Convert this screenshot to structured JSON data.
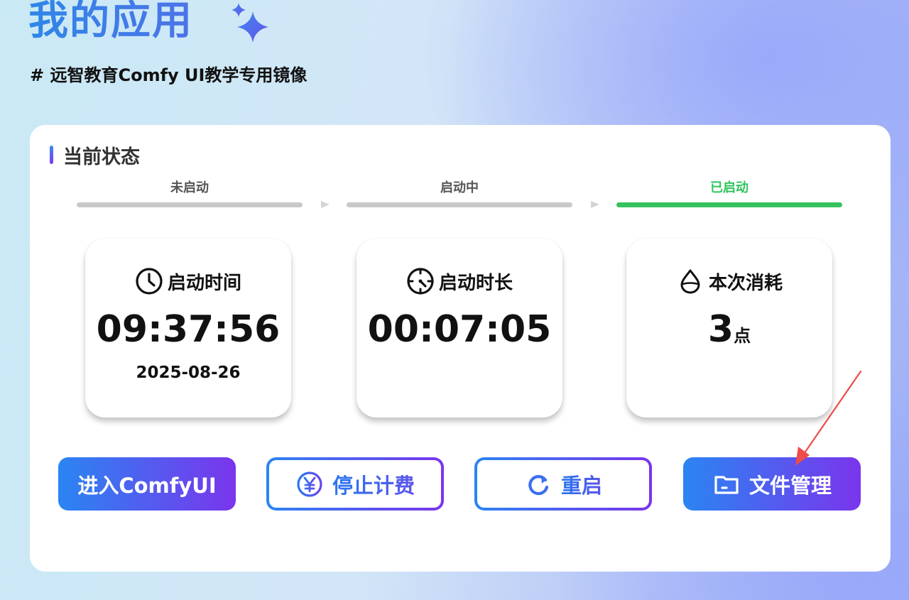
{
  "header": {
    "title": "我的应用",
    "subtitle": "# 远智教育Comfy UI教学专用镜像"
  },
  "status": {
    "section_title": "当前状态",
    "steps": [
      {
        "label": "未启动",
        "active": false
      },
      {
        "label": "启动中",
        "active": false
      },
      {
        "label": "已启动",
        "active": true
      }
    ]
  },
  "stats": {
    "start_time": {
      "label": "启动时间",
      "value": "09:37:56",
      "date": "2025-08-26",
      "icon": "clock-icon"
    },
    "duration": {
      "label": "启动时长",
      "value": "00:07:05",
      "icon": "timer-icon"
    },
    "consumption": {
      "label": "本次消耗",
      "value": "3",
      "unit": "点",
      "icon": "drop-icon"
    }
  },
  "actions": {
    "enter": "进入ComfyUI",
    "stop_billing": "停止计费",
    "restart": "重启",
    "file_manage": "文件管理"
  },
  "colors": {
    "accent_start": "#2a85f2",
    "accent_end": "#7a35ec",
    "active_step": "#35c25f",
    "annotation_arrow": "#ee4b4b"
  }
}
